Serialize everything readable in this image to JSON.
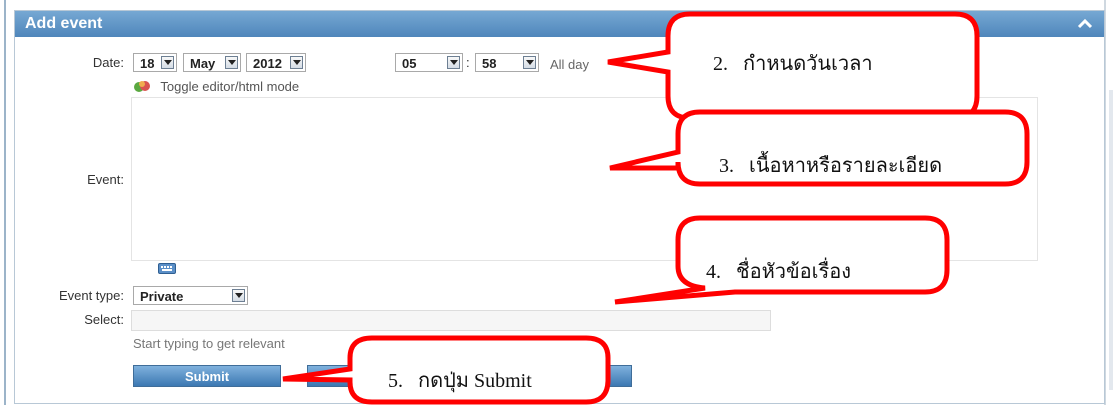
{
  "panel": {
    "title": "Add event"
  },
  "date": {
    "label": "Date:",
    "day": "18",
    "month": "May",
    "year": "2012",
    "hour": "05",
    "time_separator": ":",
    "minute": "58",
    "all_day": "All day"
  },
  "editor": {
    "toggle_label": "Toggle editor/html mode",
    "event_label": "Event:"
  },
  "event_type": {
    "label": "Event type:",
    "value": "Private"
  },
  "select": {
    "label": "Select:",
    "hint": "Start typing to get relevant"
  },
  "buttons": {
    "submit": "Submit"
  },
  "callouts": [
    {
      "number": "2.",
      "text": "กำหนดวันเวลา"
    },
    {
      "number": "3.",
      "text": "เนื้อหาหรือรายละเอียด"
    },
    {
      "number": "4.",
      "text": "ชื่อหัวข้อเรื่อง"
    },
    {
      "number": "5.",
      "text": "กดปุ่ม Submit"
    }
  ],
  "colors": {
    "header": "#4f86bb",
    "callout_outline": "#ff0000",
    "button": "#3c78b2"
  },
  "icons": [
    "collapse-up-icon",
    "toggle-editor-icon",
    "keyboard-icon",
    "dropdown-arrow-icon"
  ]
}
